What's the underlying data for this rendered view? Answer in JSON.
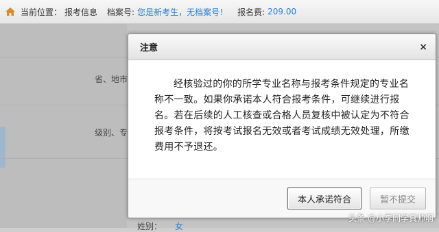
{
  "header": {
    "location_label": "当前位置：",
    "location_value": "报考信息",
    "file_no_label": "档案号:",
    "file_no_value": "您是新考生，无档案号！",
    "fee_label": "报名费:",
    "fee_value": "209.00"
  },
  "background": {
    "row1_label": "省、地市",
    "row2_label": "级别、专",
    "row3_label": "姓别：",
    "row3_value": "女"
  },
  "dialog": {
    "title": "注意",
    "close_symbol": "×",
    "message": "经核验过的你的所学专业名称与报考条件规定的专业名称不一致。如果你承诺本人符合报考条件，可继续进行报名。若在后续的人工核查或合格人员复核中被认定为不符合报考条件，将按考试报名无效或者考试成绩无效处理，所缴费用不予退还。",
    "confirm_label": "本人承诺符合",
    "cancel_label": "暂不提交"
  },
  "watermark": "头条 @小李同学真帅啊",
  "colors": {
    "link": "#2a7bd0"
  }
}
